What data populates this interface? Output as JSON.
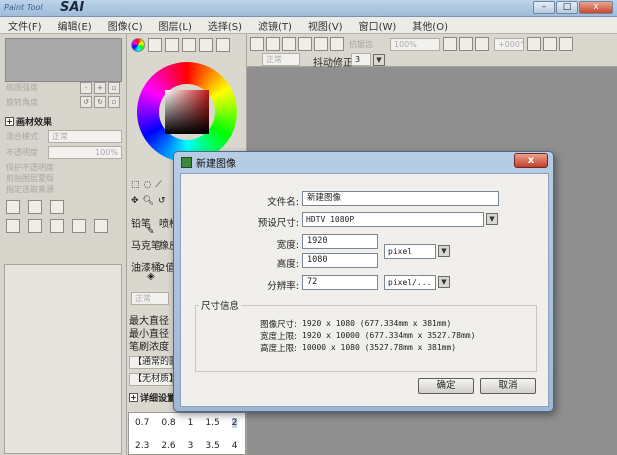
{
  "app": {
    "logo_small": "Paint Tool",
    "logo_big": "SAI",
    "window_buttons": [
      "–",
      "□",
      "x"
    ]
  },
  "menu": [
    "文件(F)",
    "编辑(E)",
    "图像(C)",
    "图层(L)",
    "选择(S)",
    "滤镜(T)",
    "视图(V)",
    "窗口(W)",
    "其他(O)"
  ],
  "left_panel": {
    "faded_rows": [
      "缩放强度",
      "旋转角度"
    ],
    "section_title": "画材效果",
    "blend_mode_label": "混合模式",
    "blend_mode_value": "正常",
    "opacity_label": "不透明度",
    "opacity_value": "100%",
    "checkboxes": [
      "保护不透明度",
      "剪贴图层蒙版",
      "指定选取来源"
    ]
  },
  "tool_panel": {
    "tools_row1": [
      "铅笔",
      "喷枪"
    ],
    "tools_row2": [
      "马克笔",
      "橡皮"
    ],
    "tools_row3": [
      "油漆桶",
      "2值笔"
    ],
    "mode_value": "正常",
    "max_size_label": "最大直径",
    "min_size_label": "最小直径",
    "density_label": "笔刷浓度",
    "brush1": "【通常的圆",
    "brush2": "【无材质】",
    "detail_label": "详细设置",
    "num_row1": [
      "0.7",
      "0.8",
      "1",
      "1.5",
      "2"
    ],
    "num_row2": [
      "2.3",
      "2.6",
      "3",
      "3.5",
      "4"
    ]
  },
  "canvas_toolbar": {
    "anti_alias_label": "抗锯齿",
    "zoom_value": "100%",
    "angle_value": "+000°",
    "mode_value": "正常",
    "stabilizer_label": "抖动修正",
    "stabilizer_value": "3"
  },
  "dialog": {
    "title": "新建图像",
    "close": "x",
    "filename_label": "文件名:",
    "filename_value": "新建图像",
    "preset_label": "预设尺寸:",
    "preset_value": "HDTV 1080P",
    "width_label": "宽度:",
    "width_value": "1920",
    "height_label": "高度:",
    "height_value": "1080",
    "unit_value": "pixel",
    "resolution_label": "分辨率:",
    "resolution_value": "72",
    "resolution_unit": "pixel/...",
    "info_title": "尺寸信息",
    "image_size_label": "图像尺寸:",
    "image_size_value": "1920 x 1080 (677.334mm x 381mm)",
    "width_limit_label": "宽度上限:",
    "width_limit_value": "1920 x 10000 (677.334mm x 3527.78mm)",
    "height_limit_label": "高度上限:",
    "height_limit_value": "10000 x 1080 (3527.78mm x 381mm)",
    "ok_label": "确定",
    "cancel_label": "取消"
  }
}
